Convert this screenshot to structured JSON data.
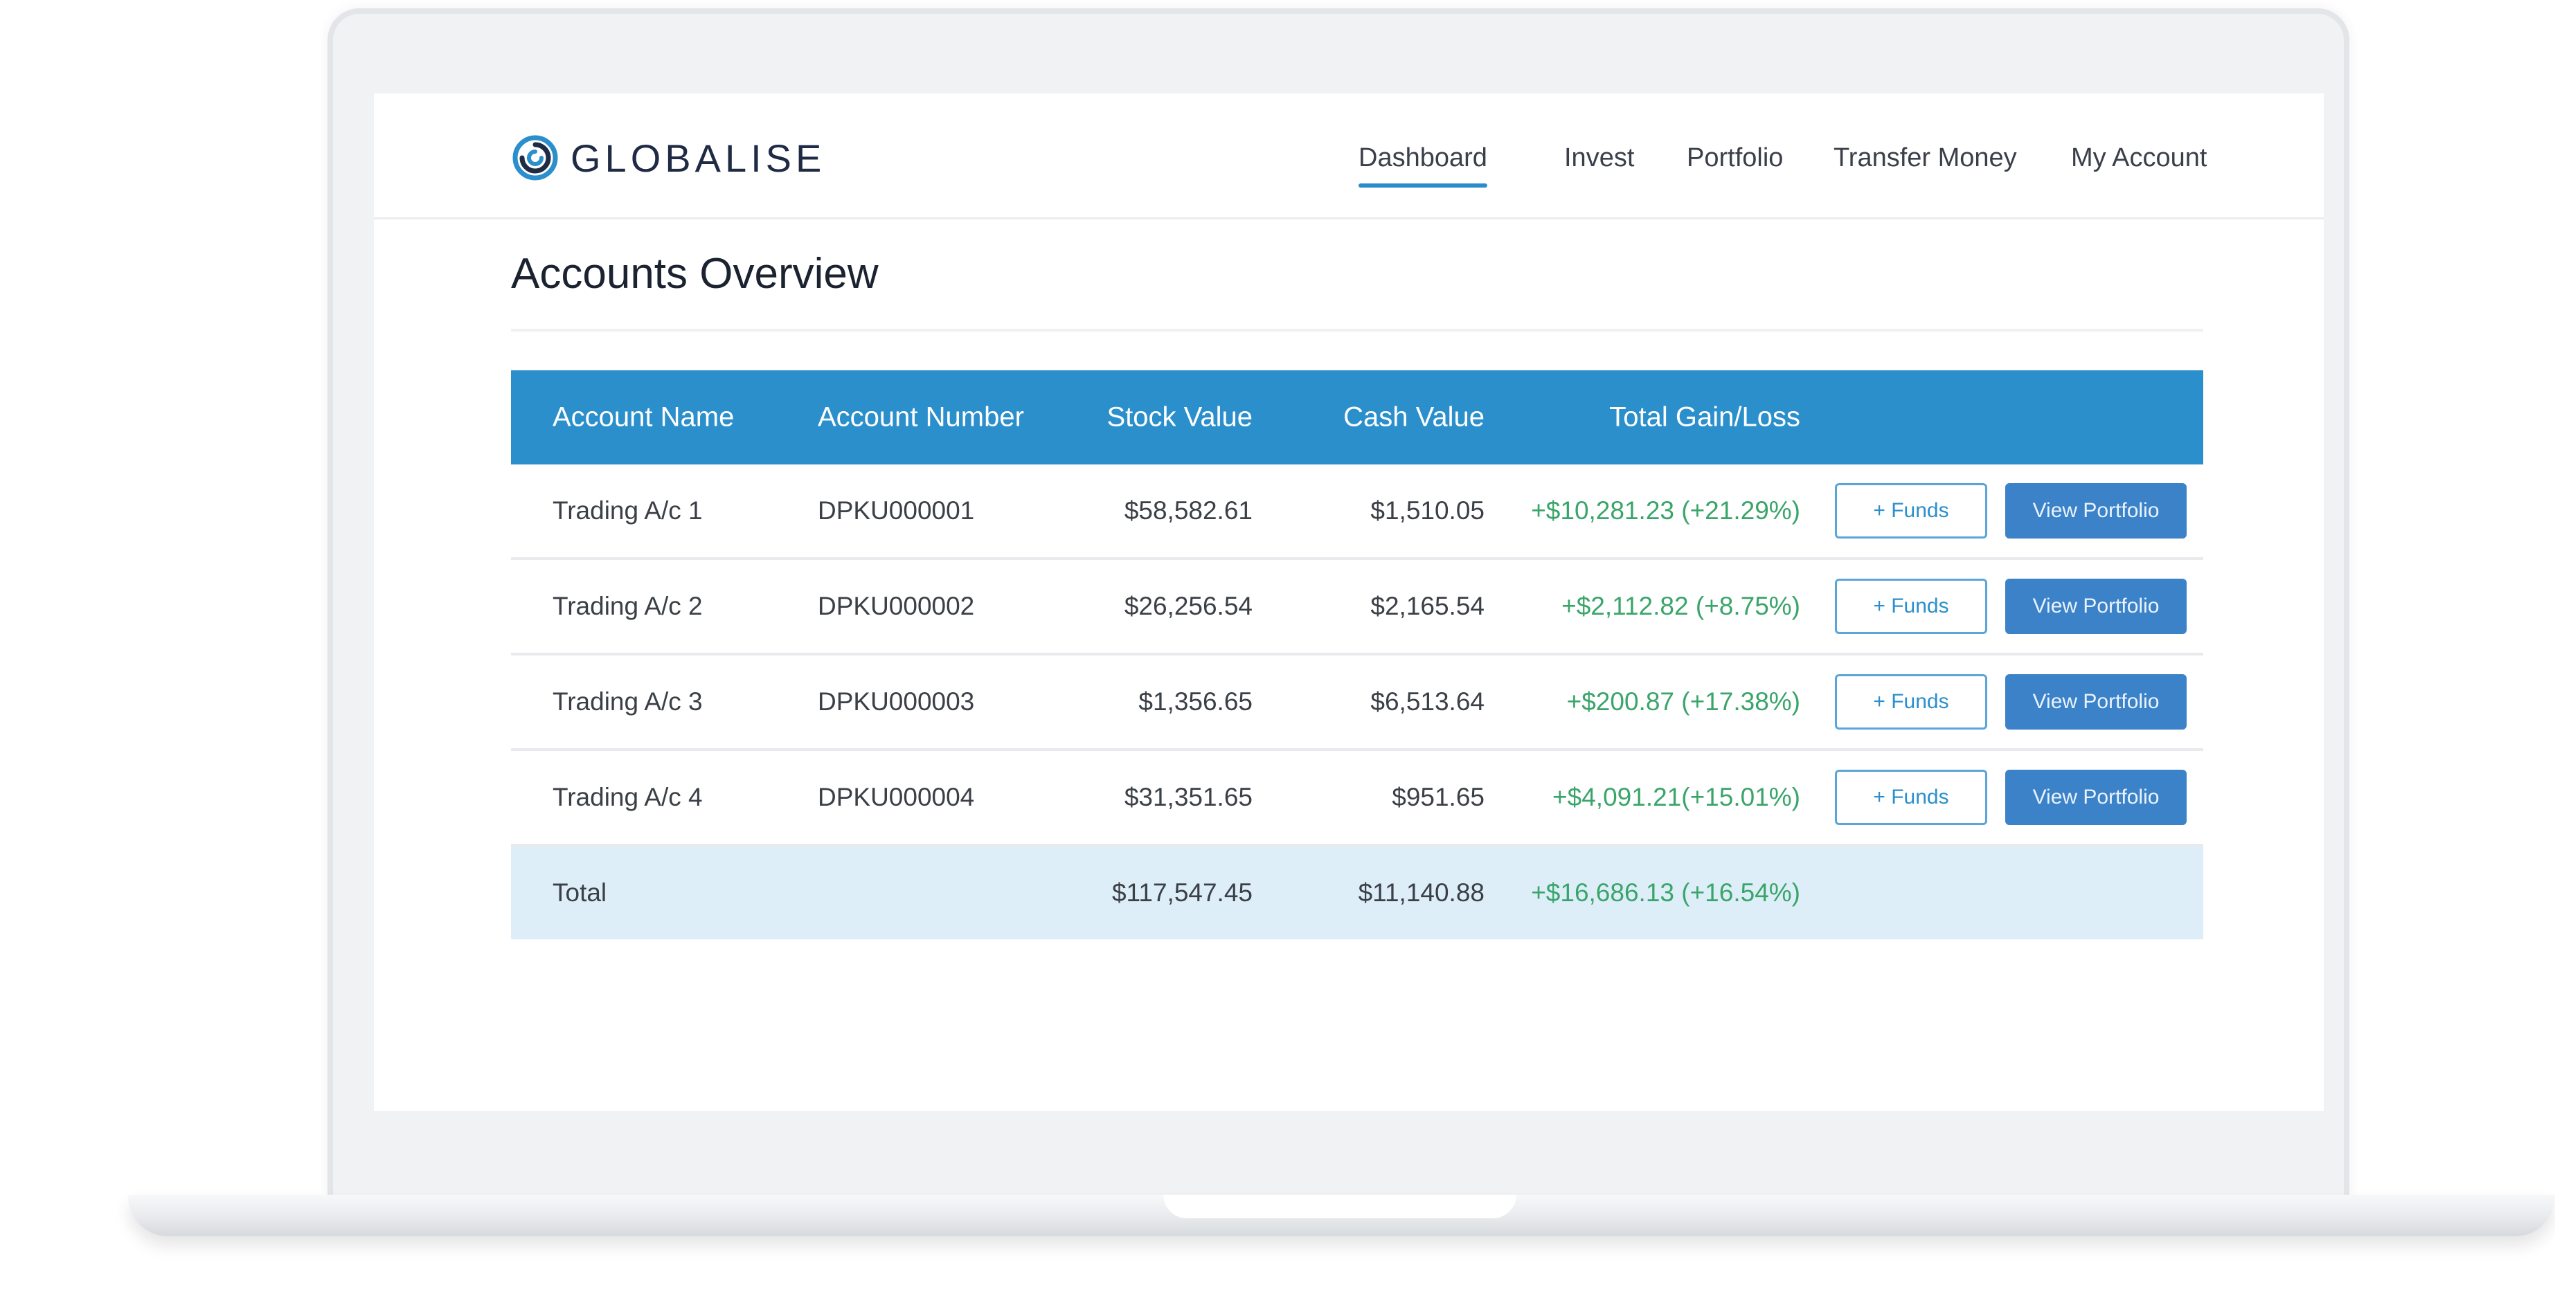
{
  "brand": {
    "name": "GLOBALISE",
    "logo_icon": "swirl-logo-icon",
    "accent": "#2b8fcc"
  },
  "nav": {
    "items": [
      {
        "label": "Dashboard",
        "active": true
      },
      {
        "label": "Invest",
        "active": false
      },
      {
        "label": "Portfolio",
        "active": false
      },
      {
        "label": "Transfer Money",
        "active": false
      },
      {
        "label": "My Account",
        "active": false
      }
    ]
  },
  "page": {
    "title": "Accounts Overview"
  },
  "table": {
    "headers": [
      "Account Name",
      "Account Number",
      "Stock Value",
      "Cash Value",
      "Total Gain/Loss"
    ],
    "rows": [
      {
        "name": "Trading A/c 1",
        "number": "DPKU000001",
        "stock": "$58,582.61",
        "cash": "$1,510.05",
        "gain": "+$10,281.23 (+21.29%)",
        "funds_label": "+ Funds",
        "view_label": "View Portfolio"
      },
      {
        "name": "Trading A/c 2",
        "number": "DPKU000002",
        "stock": "$26,256.54",
        "cash": "$2,165.54",
        "gain": "+$2,112.82 (+8.75%)",
        "funds_label": "+ Funds",
        "view_label": "View Portfolio"
      },
      {
        "name": "Trading A/c 3",
        "number": "DPKU000003",
        "stock": "$1,356.65",
        "cash": "$6,513.64",
        "gain": "+$200.87 (+17.38%)",
        "funds_label": "+ Funds",
        "view_label": "View Portfolio"
      },
      {
        "name": "Trading A/c 4",
        "number": "DPKU000004",
        "stock": "$31,351.65",
        "cash": "$951.65",
        "gain": "+$4,091.21(+15.01%)",
        "funds_label": "+ Funds",
        "view_label": "View Portfolio"
      }
    ],
    "total": {
      "label": "Total",
      "stock": "$117,547.45",
      "cash": "$11,140.88",
      "gain": "+$16,686.13 (+16.54%)"
    }
  },
  "colors": {
    "header_bg": "#2b8fcc",
    "gain": "#3aa56a",
    "total_row_bg": "#ddeef9",
    "view_button": "#3b82c9"
  }
}
